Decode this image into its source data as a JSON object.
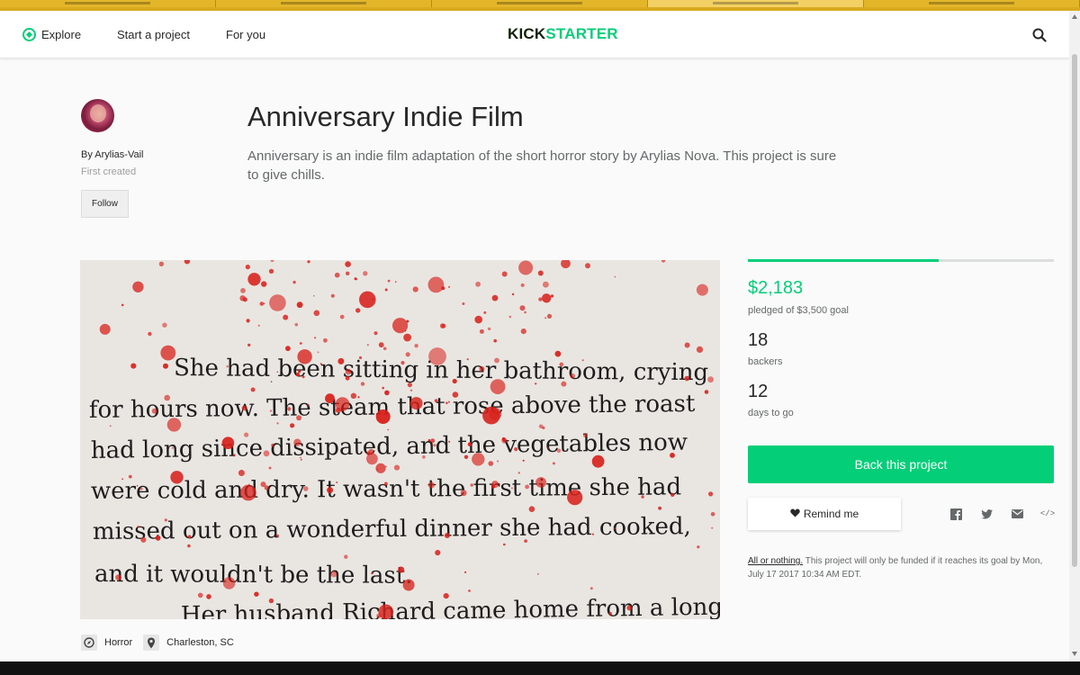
{
  "nav": {
    "explore": "Explore",
    "start": "Start a project",
    "foryou": "For you",
    "logo_part1": "KICK",
    "logo_part2": "STARTER"
  },
  "creator": {
    "by_prefix": "By",
    "name": "Arylias-Vail",
    "first_created": "First created",
    "follow": "Follow"
  },
  "project": {
    "title": "Anniversary Indie Film",
    "blurb": "Anniversary is an indie film adaptation of the short horror story by Arylias Nova. This project is sure to give chills.",
    "story_lines": [
      "She had been sitting in her bathroom, crying",
      "for hours now. The steam that rose above the roast",
      "had long since dissipated, and the vegetables now",
      "were cold and dry. It wasn't the first time she had",
      "missed out on a wonderful dinner she had cooked,",
      "and it wouldn't be the last.",
      "Her husband Richard came home from a long"
    ],
    "category": "Horror",
    "location": "Charleston, SC"
  },
  "stats": {
    "funded_fraction": 0.624,
    "pledged": "$2,183",
    "pledged_label": "pledged of $3,500 goal",
    "backers": "18",
    "backers_label": "backers",
    "days": "12",
    "days_label": "days to go"
  },
  "actions": {
    "back": "Back this project",
    "remind": "Remind me",
    "share_icons": [
      "facebook-icon",
      "twitter-icon",
      "email-icon",
      "embed-icon"
    ],
    "embed_glyph": "</>"
  },
  "fineprint": {
    "aon": "All or nothing.",
    "text": " This project will only be funded if it reaches its goal by Mon, July 17 2017 10:34 AM EDT."
  },
  "colors": {
    "brand_green": "#05ce78",
    "blood_red": "#d8201a"
  }
}
